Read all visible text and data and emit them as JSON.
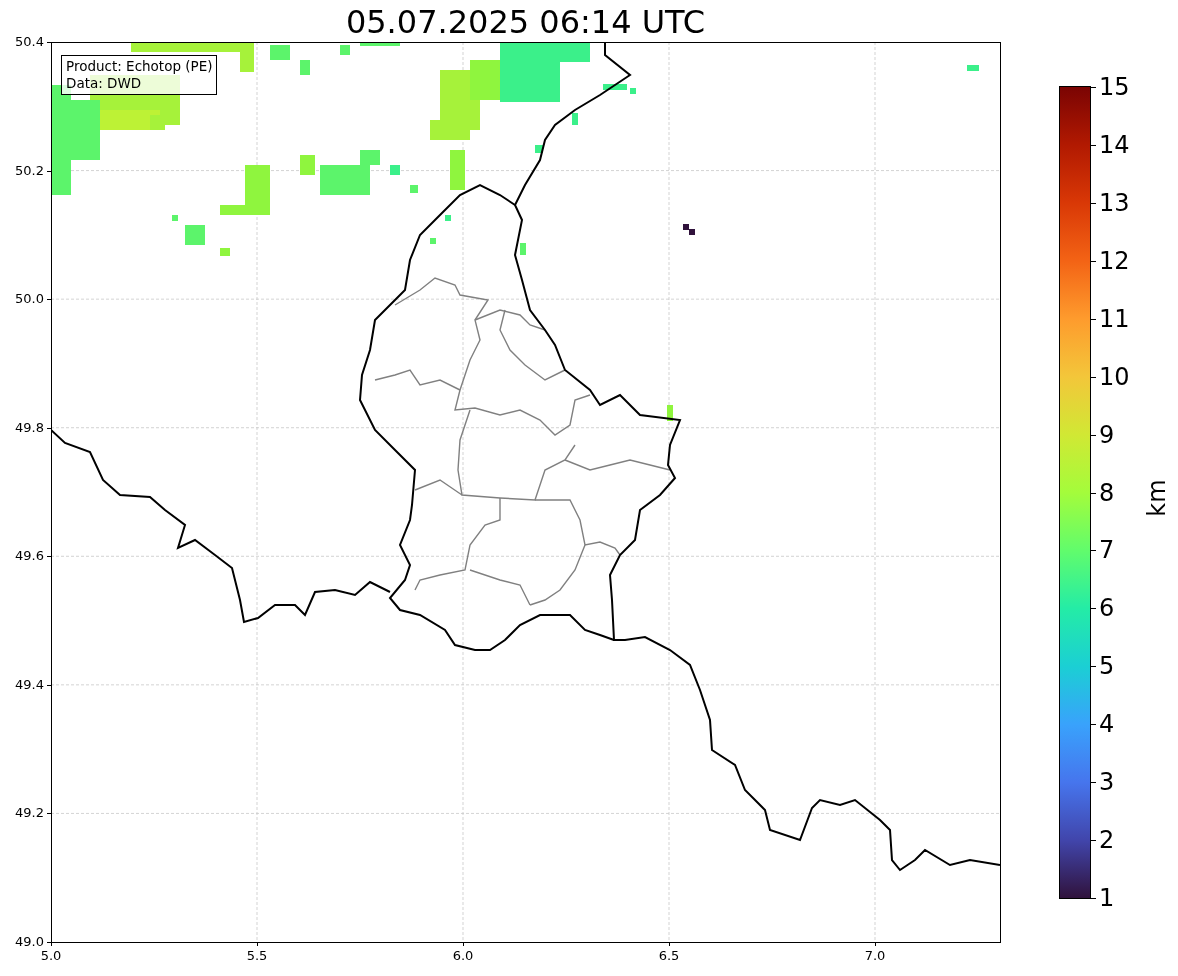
{
  "title": "05.07.2025 06:14 UTC",
  "legend": [
    "Product: Echotop (PE)",
    "Data: DWD"
  ],
  "x_ticks": [
    "5.0",
    "5.5",
    "6.0",
    "6.5",
    "7.0"
  ],
  "y_ticks": [
    "50.4",
    "50.2",
    "50.0",
    "49.8",
    "49.6",
    "49.4",
    "49.2",
    "49.0"
  ],
  "colorbar": {
    "ticks": [
      "15",
      "14",
      "13",
      "12",
      "11",
      "10",
      "9",
      "8",
      "7",
      "6",
      "5",
      "4",
      "3",
      "2",
      "1"
    ],
    "label": "km"
  }
}
